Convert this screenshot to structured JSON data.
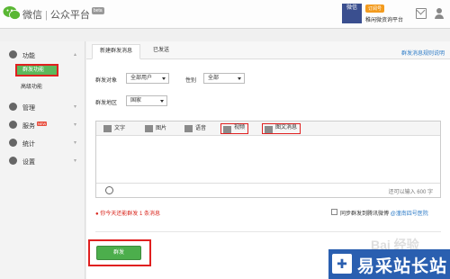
{
  "header": {
    "brand": "微信",
    "brand_suffix": "公众平台",
    "beta": "beta",
    "account_avatar_text": "微信",
    "account_type": "订阅号",
    "account_name": "稚闲微资询平台"
  },
  "sidebar": {
    "items": [
      {
        "label": "功能",
        "icon": "function-icon"
      },
      {
        "label": "管理",
        "icon": "manage-icon"
      },
      {
        "label": "服务",
        "icon": "service-icon",
        "badge": "NEW"
      },
      {
        "label": "统计",
        "icon": "stats-icon"
      },
      {
        "label": "设置",
        "icon": "settings-icon"
      }
    ],
    "subitems": [
      {
        "label": "群发功能",
        "active": true
      },
      {
        "label": "高级功能",
        "active": false
      }
    ]
  },
  "tabs": {
    "active": "新建群发消息",
    "second": "已发送",
    "help_link": "群发消息规则说明"
  },
  "form": {
    "target_label": "群发对象",
    "target_value": "全部用户",
    "gender_label": "性别",
    "gender_value": "全部",
    "region_label": "群发地区",
    "region_value": "国家"
  },
  "editor": {
    "tools": [
      "文字",
      "图片",
      "语音",
      "视频",
      "图文消息"
    ],
    "counter": "还可以输入 600 字"
  },
  "limit_notice": "你今天还能群发 1 条消息",
  "sync": {
    "text": "同步群发到腾讯微博",
    "link": "@潼南四号医院"
  },
  "send_button": "群发",
  "watermark": {
    "jingyan": "Bai 经验",
    "site": "易采站长站"
  },
  "colors": {
    "accent_green": "#4cae4c",
    "highlight_red": "#e02020",
    "link_blue": "#2e7cc7"
  }
}
